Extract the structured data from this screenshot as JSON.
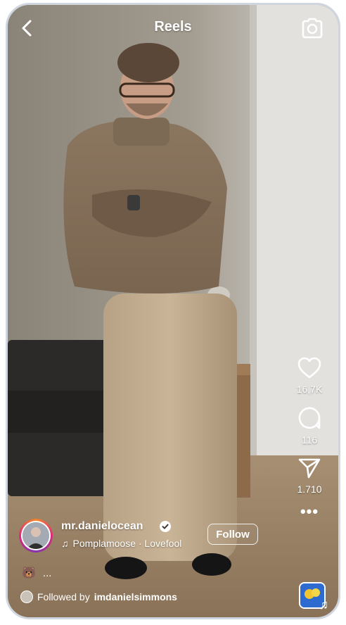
{
  "header": {
    "title": "Reels"
  },
  "actions": {
    "likes": "16,7K",
    "comments": "116",
    "shares": "1.710"
  },
  "author": {
    "username": "mr.danielocean",
    "follow_label": "Follow"
  },
  "music": {
    "text": "Pomplamoose · Lovefool"
  },
  "caption": {
    "emoji": "🐻",
    "more": "..."
  },
  "followed_by": {
    "prefix": "Followed by",
    "name": "imdanielsimmons"
  },
  "icons": [
    "back-icon",
    "camera-icon",
    "heart-icon",
    "comment-icon",
    "share-icon",
    "more-icon",
    "verified-icon",
    "music-note-icon"
  ],
  "colors": {
    "text": "#ffffff",
    "verified": "#3897f0",
    "avatar_ring": "#dd2a7b"
  }
}
